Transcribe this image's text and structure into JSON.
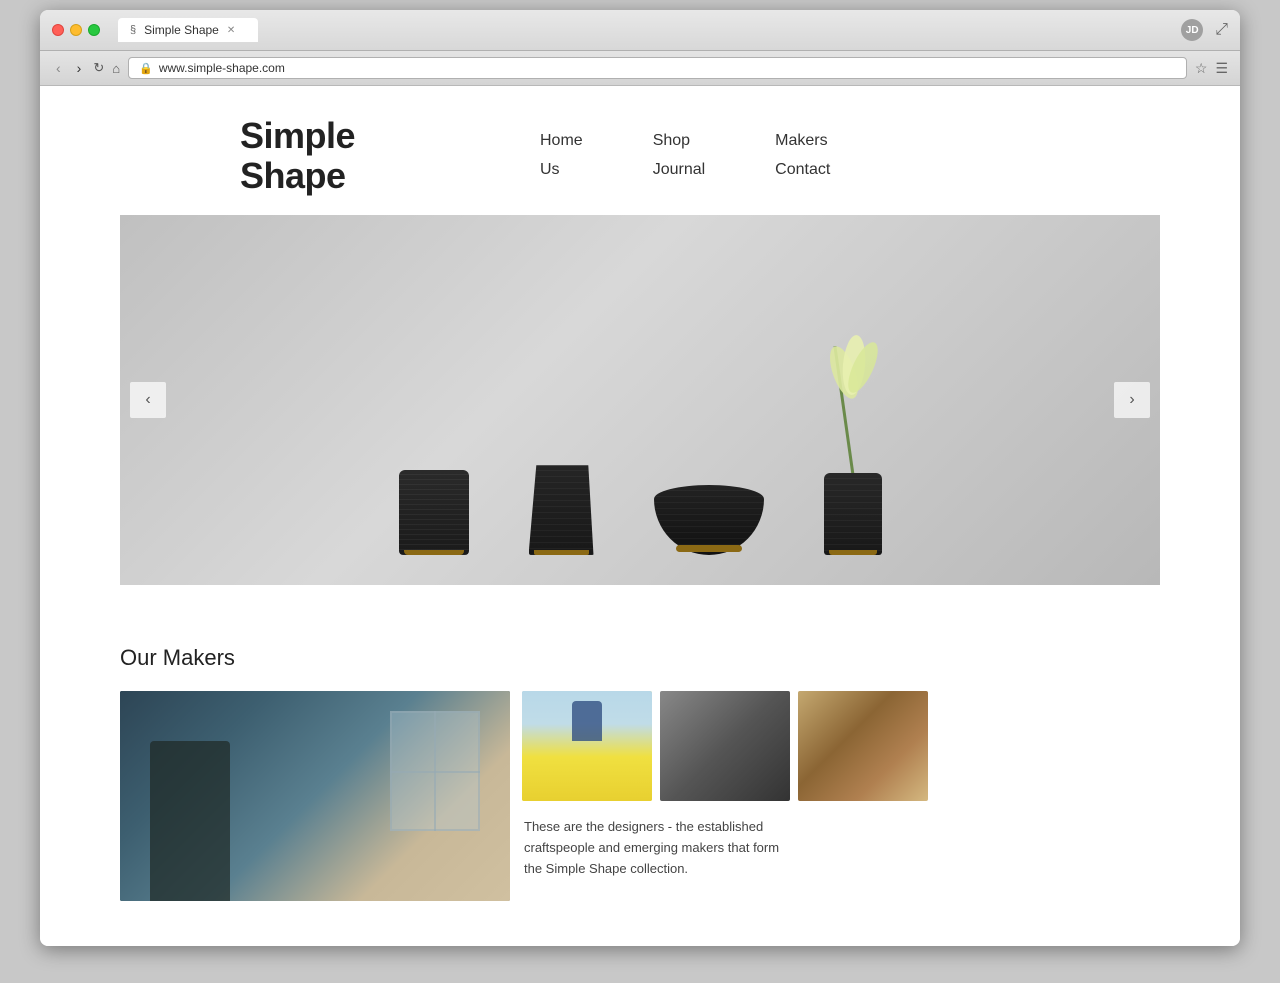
{
  "browser": {
    "title": "Simple Shape",
    "url": "www.simple-shape.com",
    "user_initials": "JD",
    "tab_favicon": "§"
  },
  "site": {
    "logo_line1": "Simple",
    "logo_line2": "Shape",
    "nav": {
      "col1": [
        "Home",
        "Us"
      ],
      "col2": [
        "Shop",
        "Journal"
      ],
      "col3": [
        "Makers",
        "Contact"
      ]
    },
    "slider": {
      "prev_label": "‹",
      "next_label": "›"
    },
    "makers": {
      "title": "Our Makers",
      "description": "These are the designers - the established craftspeople and emerging makers that form the Simple Shape collection."
    }
  }
}
